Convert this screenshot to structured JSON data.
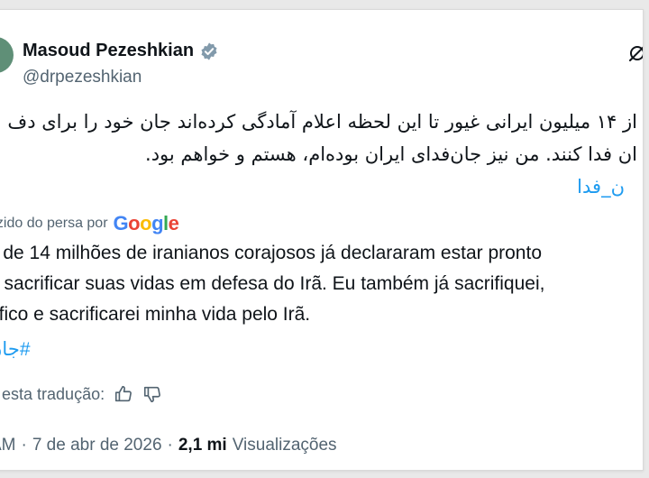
{
  "post": {
    "author_name": "Masoud Pezeshkian",
    "author_handle": "@drpezeshkian",
    "original_line1": "از ۱۴ میلیون ایرانی غیور تا این لحظه اعلام آمادگی کرده‌اند جان خود را برای دف",
    "original_line2": "ان فدا کنند. من نیز جان‌فدای ایران بوده‌ام، هستم و خواهم بود.",
    "original_hashtag": "ن_فدا",
    "translated_label": "uzido do persa por",
    "translator": "Google",
    "translation_line1": "s de 14 milhões de iranianos corajosos já declararam estar pronto",
    "translation_line2": "a sacrificar suas vidas em defesa do Irã. Eu também já sacrifiquei,",
    "translation_line3": "rifico e sacrificarei minha vida pelo Irã.",
    "translation_hashtag": "جان#",
    "rate_label": "e esta tradução:",
    "time": "AM",
    "date": "7 de abr de 2026",
    "views_count": "2,1 mi",
    "views_label": "Visualizações",
    "separator": "·"
  },
  "colors": {
    "link": "#1d9bf0",
    "muted": "#536471",
    "verified_badge": "#829aab"
  }
}
